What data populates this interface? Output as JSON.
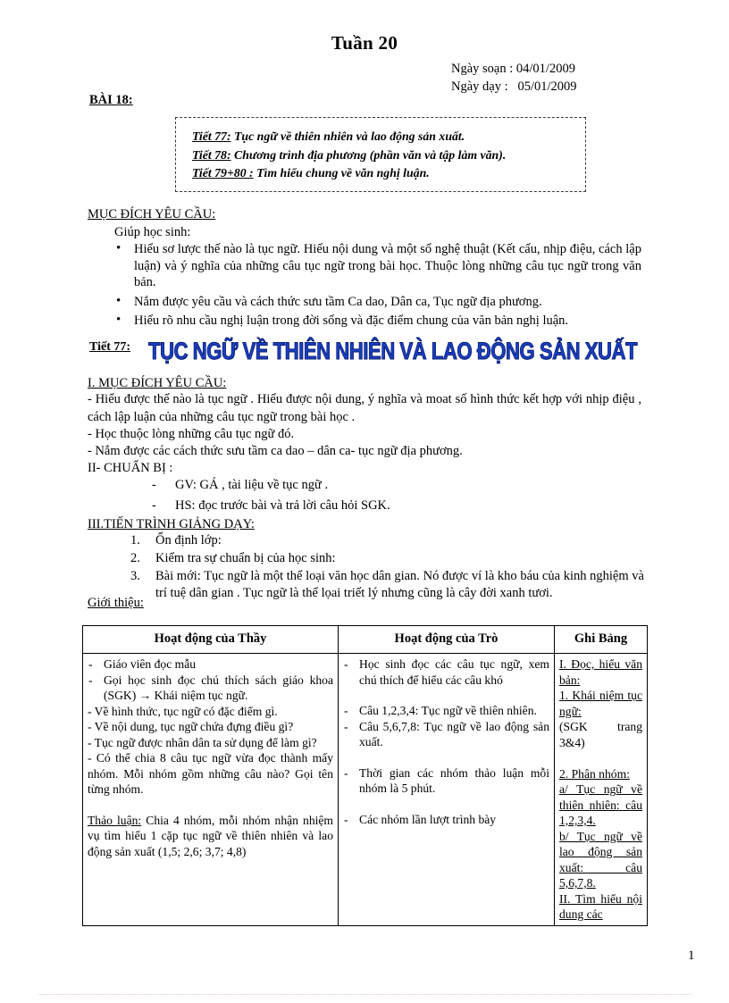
{
  "document": {
    "title": "Tuần 20",
    "page_number": "1"
  },
  "dates": {
    "prepared": "Ngày soạn : 04/01/2009",
    "taught": "Ngày dạy :   05/01/2009"
  },
  "lesson": {
    "bai_label": "BÀI 18:"
  },
  "tiet_box": [
    {
      "num": "Tiết 77:",
      "text": " Tục ngữ về thiên nhiên và lao động sản xuất."
    },
    {
      "num": "Tiết 78:",
      "text": " Chương trình địa phương (phần văn và tập làm văn)."
    },
    {
      "num": "Tiết 79+80 :",
      "text": " Tìm hiểu chung về văn nghị luận."
    }
  ],
  "objectives": {
    "heading": "MỤC ĐÍCH YÊU CẦU:",
    "intro": "Giúp học sinh:",
    "items": [
      "Hiểu sơ lược thế nào là tục ngữ. Hiểu nội dung và một số nghệ thuật (Kết cấu, nhịp điệu, cách lập luận) và ý nghĩa  của những câu tục ngữ trong bài học. Thuộc lòng những câu tục ngữ trong văn bản.",
      "Nắm được yêu cầu và cách thức sưu tầm Ca dao, Dân ca, Tục ngữ địa phương.",
      "Hiểu rõ nhu cầu nghị luận trong đời sống và đặc điểm chung của văn bản nghị luận."
    ]
  },
  "tiet77": {
    "label": "Tiết 77:",
    "wordart_title": "TỤC NGỮ VỀ THIÊN NHIÊN VÀ LAO ĐỘNG SẢN XUẤT",
    "wordart_color": "#1a3fc4"
  },
  "section_i": {
    "heading": "I. MỤC ĐÍCH YÊU CẦU:",
    "p1": "- Hiểu được thế nào là tục ngữ . Hiểu được nội dung, ý nghĩa và moat số hình thức kết hợp với nhịp điệu , cách lập luận của những câu tục ngữ trong bài học .",
    "p2": "- Học thuộc lòng những câu tục ngữ đó.",
    "p3": "- Nắm được các cách thức sưu tầm ca dao – dân ca- tục ngữ địa phương."
  },
  "section_ii": {
    "heading": "II- CHUẨN BỊ :",
    "items": [
      "GV: GÁ , tài liệu về tục ngữ .",
      "HS: đọc trước bài và trả lời câu hỏi SGK."
    ]
  },
  "section_iii": {
    "heading": "III.TIẾN TRÌNH GIẢNG DẠY:",
    "items": [
      "Ổn định lớp:",
      "Kiểm tra sự chuẩn bị của học sinh:",
      "Bài mới: Tục ngữ là một thể loại văn học dân gian. Nó được ví là kho báu của kinh nghiệm và trí tuệ dân gian . Tục ngữ là thể lọai triết lý nhưng cũng là cây đời xanh tươi."
    ],
    "intro_label": "Giới thiệu:"
  },
  "table": {
    "headers": [
      "Hoạt động của Thầy",
      "Hoạt động của Trò",
      "Ghi Bảng"
    ],
    "teacher": {
      "dash_items": [
        "Giáo viên đọc mẫu",
        "Gọi học sinh đọc chú thích sách giáo khoa (SGK) → Khái niệm tục ngữ."
      ],
      "paragraphs": [
        "- Về hình thức, tục ngữ có đặc điểm gì.",
        "- Về nội dung, tục ngữ chứa đựng điều gì?",
        "- Tục ngữ được nhân dân ta sử dụng để làm gì?",
        "- Có thể chia 8 câu tục ngữ vừa đọc thành mấy nhóm. Mỗi nhóm gồm những câu nào? Gọi tên từng nhóm."
      ],
      "discussion_label": "Thảo luận:",
      "discussion_text": " Chia 4 nhóm, mỗi nhóm nhận nhiệm vụ tìm hiểu 1 cặp tục ngữ về thiên nhiên và lao động sản xuất (1,5; 2,6; 3,7; 4,8)"
    },
    "student": {
      "items": [
        "Học sinh đọc các câu tục ngữ, xem chú thích để hiểu các câu khó",
        "Câu 1,2,3,4: Tục ngữ về thiên nhiên.",
        "Câu 5,6,7,8: Tục ngữ về lao động sản xuất.",
        "Thời gian các nhóm thảo luận mỗi nhóm là 5 phút.",
        "Các nhóm lần lượt trình bày"
      ]
    },
    "board": {
      "lines": [
        "I. Đọc, hiểu văn bản:",
        "1. Khái niệm tục ngữ:",
        "(SGK trang 3&4)",
        "2. Phân nhóm:",
        "a/ Tục ngữ về thiên nhiên: câu 1,2,3,4.",
        "b/ Tục ngữ về lao động sản xuất: câu 5,6,7,8.",
        "II. Tìm hiểu nội dung các"
      ]
    }
  }
}
